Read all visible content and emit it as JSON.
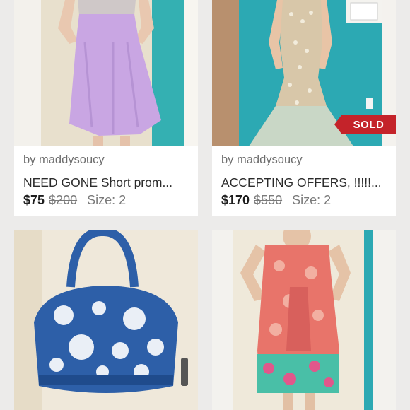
{
  "listings": [
    {
      "seller": "by maddysoucy",
      "title": "NEED GONE Short prom...",
      "price": "$75",
      "original_price": "$200",
      "size": "Size: 2",
      "image_icon": "lavender-short-dress-photo"
    },
    {
      "seller": "by maddysoucy",
      "title": "ACCEPTING OFFERS, !!!!!...",
      "price": "$170",
      "original_price": "$550",
      "size": "Size: 2",
      "badge": "SOLD",
      "image_icon": "mermaid-gown-photo"
    },
    {
      "image_icon": "blue-floral-bag-photo"
    },
    {
      "image_icon": "coral-print-dress-photo"
    }
  ],
  "colors": {
    "background": "#ecebea",
    "sold_badge": "#c4232a",
    "teal_wall": "#2ca9b3"
  }
}
